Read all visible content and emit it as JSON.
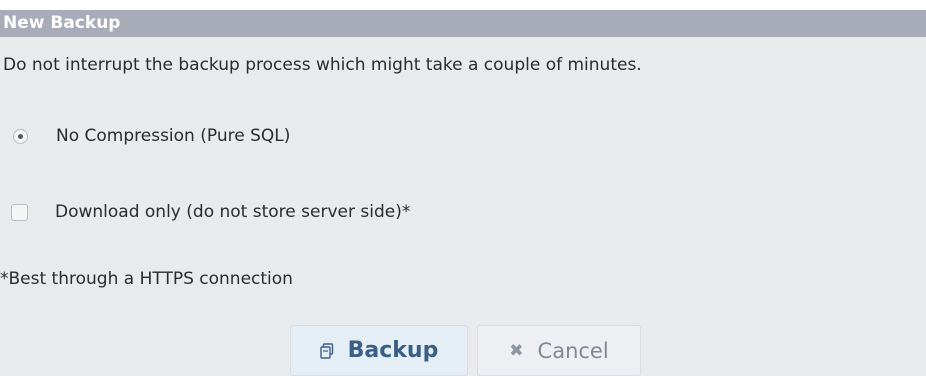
{
  "dialog": {
    "title": "New Backup",
    "notice": "Do not interrupt the backup process which might take a couple of minutes.",
    "options": {
      "compression_label": "No Compression (Pure SQL)",
      "compression_selected": true,
      "download_only_label": "Download only (do not store server side)*",
      "download_only_checked": false
    },
    "footnote": "*Best through a HTTPS connection",
    "buttons": {
      "backup_label": "Backup",
      "backup_icon": "backup-icon",
      "cancel_label": "Cancel",
      "cancel_icon": "close-icon"
    }
  },
  "colors": {
    "title_bar": "#a7acb8",
    "dialog_bg": "#e9eaec",
    "backup_text": "#3a5f86",
    "cancel_text": "#7e8a98"
  }
}
